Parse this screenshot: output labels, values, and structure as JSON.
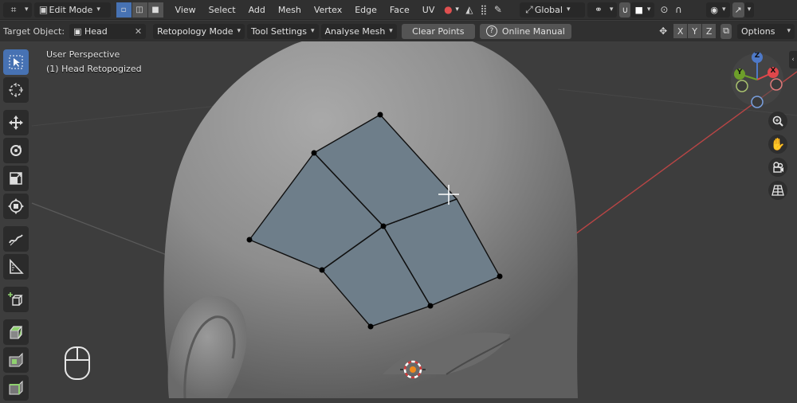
{
  "header": {
    "mode": "Edit Mode",
    "menus": [
      "View",
      "Select",
      "Add",
      "Mesh",
      "Vertex",
      "Edge",
      "Face",
      "UV"
    ],
    "orientation": "Global"
  },
  "tool_header": {
    "target_label": "Target Object:",
    "target_value": "Head",
    "retopology_mode": "Retopology Mode",
    "tool_settings": "Tool Settings",
    "analyse_mesh": "Analyse Mesh",
    "clear_points": "Clear Points",
    "online_manual": "Online Manual",
    "axes": [
      "X",
      "Y",
      "Z"
    ],
    "options": "Options"
  },
  "viewport": {
    "perspective": "User Perspective",
    "object": "(1) Head Retopogized"
  },
  "gizmo": {
    "x": "X",
    "y": "Y",
    "z": "Z"
  },
  "colors": {
    "accent": "#4772b3",
    "x_axis": "#e0474b",
    "y_axis": "#6d9e2a",
    "z_axis": "#4e79c8"
  }
}
